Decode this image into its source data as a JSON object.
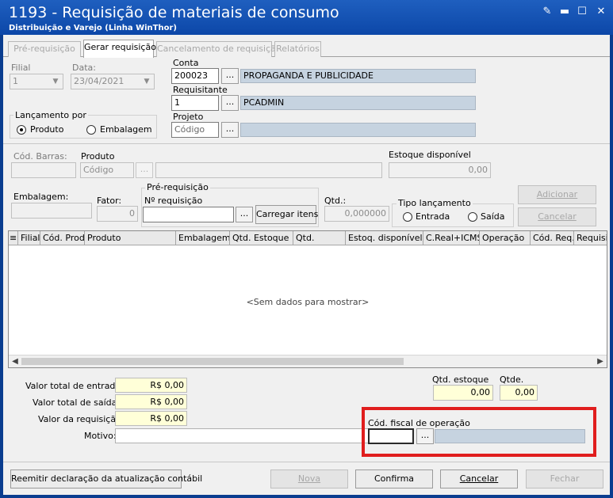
{
  "window": {
    "title": "1193 - Requisição de materiais de consumo",
    "subtitle": "Distribuição e Varejo (Linha WinThor)"
  },
  "tabs": [
    {
      "label": "Pré-requisição",
      "active": false
    },
    {
      "label": "Gerar requisição",
      "active": true
    },
    {
      "label": "Cancelamento de requisição",
      "active": false
    },
    {
      "label": "Relatórios",
      "active": false
    }
  ],
  "header": {
    "filial_label": "Filial",
    "filial_value": "1",
    "data_label": "Data:",
    "data_value": "23/04/2021",
    "conta_label": "Conta",
    "conta_code": "200023",
    "conta_desc": "PROPAGANDA E PUBLICIDADE",
    "requisitante_label": "Requisitante",
    "requisitante_code": "1",
    "requisitante_desc": "PCADMIN",
    "projeto_label": "Projeto",
    "projeto_placeholder": "Código",
    "projeto_desc": "",
    "lancamento_title": "Lançamento por",
    "opt_produto": "Produto",
    "opt_embalagem": "Embalagem",
    "selected_option": "Produto"
  },
  "item": {
    "cod_barras_label": "Cód. Barras:",
    "produto_label": "Produto",
    "produto_placeholder": "Código",
    "estoque_label": "Estoque disponível",
    "estoque_value": "0,00",
    "embalagem_label": "Embalagem:",
    "fator_label": "Fator:",
    "fator_value": "0",
    "prereq_group": "Pré-requisição",
    "nreq_label": "Nº requisição",
    "carregar_label": "Carregar itens",
    "qtd_label": "Qtd.:",
    "qtd_value": "0,000000",
    "tipo_group": "Tipo lançamento",
    "opt_entrada": "Entrada",
    "opt_saida": "Saída",
    "adicionar_label": "Adicionar",
    "cancelar_label": "Cancelar"
  },
  "grid": {
    "columns": [
      "Filial",
      "Cód. Prod.",
      "Produto",
      "Embalagem",
      "Qtd. Estoque",
      "Qtd.",
      "Estoq. disponível",
      "C.Real+ICMS",
      "Operação",
      "Cód. Req.",
      "Requisit"
    ],
    "empty_text": "<Sem dados para mostrar>"
  },
  "totals": {
    "entradas_label": "Valor total de entradas:",
    "entradas_value": "R$ 0,00",
    "saidas_label": "Valor total de saídas:",
    "saidas_value": "R$ 0,00",
    "requisicao_label": "Valor da requisição:",
    "requisicao_value": "R$ 0,00",
    "motivo_label": "Motivo:",
    "qtd_estoque_label": "Qtd. estoque",
    "qtd_estoque_value": "0,00",
    "qtde_label": "Qtde.",
    "qtde_value": "0,00",
    "cfop_label": "Cód. fiscal de operação"
  },
  "footer": {
    "reemitir_label": "Reemitir declaração da atualização contábil",
    "nova_label": "Nova",
    "confirma_label": "Confirma",
    "cancelar_label": "Cancelar",
    "fechar_label": "Fechar"
  },
  "colors": {
    "title_bar": "#0c47a8",
    "highlight": "#e01e1e",
    "readonly_field": "#c6d3e0",
    "value_field": "#ffffd8"
  }
}
